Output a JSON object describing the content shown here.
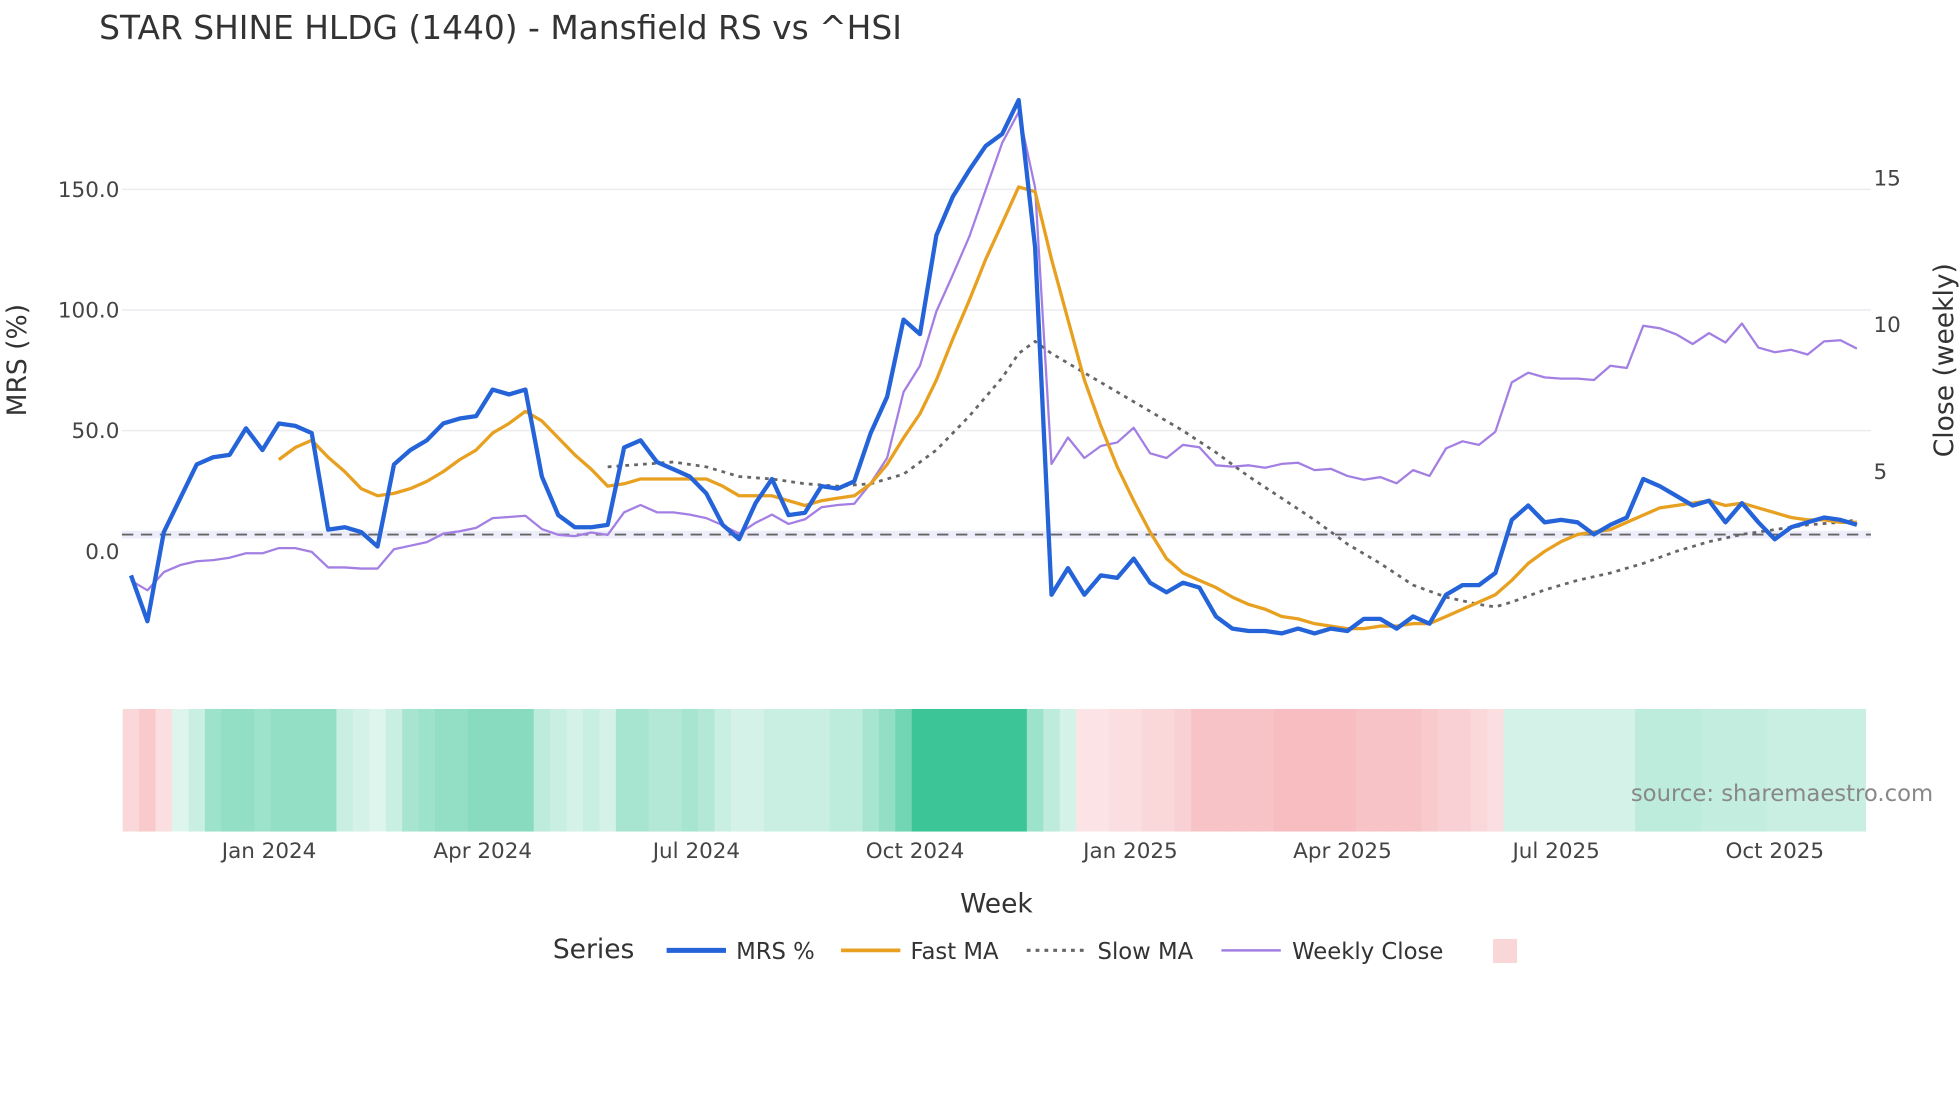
{
  "chart_data": {
    "type": "line",
    "title": "STAR SHINE HLDG (1440) - Mansfield RS vs ^HSI",
    "xlabel": "Week",
    "ylabel": "MRS (%)",
    "y2label": "Close (weekly)",
    "ylim": [
      -47,
      196
    ],
    "y2lim": [
      -1.6,
      18.4
    ],
    "yticks": [
      "0.0",
      "50.0",
      "100.0",
      "150.0"
    ],
    "ytick_values": [
      0,
      50,
      100,
      150
    ],
    "y2ticks": [
      "5",
      "10",
      "15"
    ],
    "y2tick_values": [
      5,
      10,
      15
    ],
    "x_note": "x = week index (weekly points, ~Nov 2023 to Nov 2025)",
    "xlim": [
      -0.55,
      105.85
    ],
    "xticks": [
      {
        "label": "Jan 2024",
        "x": 8.4
      },
      {
        "label": "Apr 2024",
        "x": 21.4
      },
      {
        "label": "Jul 2024",
        "x": 34.4
      },
      {
        "label": "Oct 2024",
        "x": 47.7
      },
      {
        "label": "Jan 2025",
        "x": 60.8
      },
      {
        "label": "Apr 2025",
        "x": 73.7
      },
      {
        "label": "Jul 2025",
        "x": 86.7
      },
      {
        "label": "Oct 2025",
        "x": 100.0
      }
    ],
    "grid": true,
    "legend_title": "Series",
    "legend_position": "bottom",
    "source": "source: sharemaestro.com",
    "series": [
      {
        "name": "MRS %",
        "axis": "left",
        "color": "#2563d9",
        "style": "solid",
        "start": 0,
        "values": [
          -10,
          -29,
          8,
          22,
          36,
          39,
          40,
          51,
          42,
          53,
          52,
          49,
          9,
          10,
          8,
          2,
          36,
          42,
          46,
          53,
          55,
          56,
          67,
          65,
          67,
          31,
          15,
          10,
          10,
          11,
          43,
          46,
          37,
          34,
          31,
          24,
          11,
          5,
          20,
          30,
          15,
          16,
          27,
          26,
          29,
          49,
          64,
          96,
          90,
          131,
          147,
          158,
          168,
          173,
          187,
          126,
          -18,
          -7,
          -18,
          -10,
          -11,
          -3,
          -13,
          -17,
          -13,
          -15,
          -27,
          -32,
          -33,
          -33,
          -34,
          -32,
          -34,
          -32,
          -33,
          -28,
          -28,
          -32,
          -27,
          -30,
          -18,
          -14,
          -14,
          -9,
          13,
          19,
          12,
          13,
          12,
          7,
          11,
          14,
          30,
          27,
          23,
          19,
          21,
          12,
          20,
          12,
          5,
          10,
          12,
          14,
          13,
          11
        ]
      },
      {
        "name": "Fast MA",
        "axis": "left",
        "color": "#e8a020",
        "style": "solid",
        "start": 9,
        "values": [
          38,
          43,
          46,
          39,
          33,
          26,
          23,
          24,
          26,
          29,
          33,
          38,
          42,
          49,
          53,
          58,
          54,
          47,
          40,
          34,
          27,
          28,
          30,
          30,
          30,
          30,
          30,
          27,
          23,
          23,
          23,
          21,
          19,
          21,
          22,
          23,
          28,
          36,
          47,
          57,
          71,
          88,
          104,
          121,
          136,
          151,
          149,
          121,
          96,
          71,
          52,
          35,
          21,
          8,
          -3,
          -9,
          -12,
          -15,
          -19,
          -22,
          -24,
          -27,
          -28,
          -30,
          -31,
          -32,
          -32,
          -31,
          -31,
          -30,
          -30,
          -27,
          -24,
          -21,
          -18,
          -12,
          -5,
          0,
          4,
          7,
          8,
          9,
          12,
          15,
          18,
          19,
          20,
          21,
          19,
          20,
          18,
          16,
          14,
          13,
          13,
          12,
          12
        ]
      },
      {
        "name": "Slow MA",
        "axis": "left",
        "color": "#666666",
        "style": "dotted",
        "points": [
          [
            29,
            35
          ],
          [
            31,
            36
          ],
          [
            33,
            37
          ],
          [
            35,
            35
          ],
          [
            37,
            31
          ],
          [
            39,
            30
          ],
          [
            41,
            28
          ],
          [
            43,
            27
          ],
          [
            45,
            28
          ],
          [
            47,
            32
          ],
          [
            49,
            42
          ],
          [
            51,
            56
          ],
          [
            53,
            72
          ],
          [
            54,
            82
          ],
          [
            55,
            87
          ],
          [
            56,
            82
          ],
          [
            58,
            74
          ],
          [
            60,
            66
          ],
          [
            62,
            58
          ],
          [
            64,
            50
          ],
          [
            66,
            41
          ],
          [
            68,
            31
          ],
          [
            70,
            22
          ],
          [
            72,
            13
          ],
          [
            74,
            3
          ],
          [
            76,
            -5
          ],
          [
            78,
            -14
          ],
          [
            80,
            -19
          ],
          [
            82,
            -22
          ],
          [
            83,
            -23
          ],
          [
            84,
            -21
          ],
          [
            86,
            -16
          ],
          [
            88,
            -12
          ],
          [
            90,
            -9
          ],
          [
            92,
            -5
          ],
          [
            94,
            0
          ],
          [
            96,
            4
          ],
          [
            98,
            7
          ],
          [
            100,
            9
          ],
          [
            102,
            11
          ],
          [
            104,
            12
          ],
          [
            105,
            13
          ]
        ]
      },
      {
        "name": "Weekly Close",
        "axis": "right",
        "color": "#a47fe3",
        "style": "solid",
        "start": 0,
        "values": [
          1.27,
          0.94,
          1.56,
          1.8,
          1.93,
          1.97,
          2.05,
          2.2,
          2.2,
          2.38,
          2.38,
          2.25,
          1.72,
          1.72,
          1.68,
          1.68,
          2.34,
          2.46,
          2.58,
          2.87,
          2.95,
          3.07,
          3.4,
          3.44,
          3.48,
          3.03,
          2.83,
          2.79,
          2.91,
          2.83,
          3.6,
          3.85,
          3.6,
          3.6,
          3.52,
          3.4,
          3.16,
          2.87,
          3.24,
          3.52,
          3.2,
          3.36,
          3.77,
          3.85,
          3.89,
          4.59,
          5.45,
          7.7,
          8.6,
          10.45,
          11.7,
          13.0,
          14.6,
          16.2,
          17.25,
          14.67,
          5.25,
          6.15,
          5.45,
          5.86,
          5.98,
          6.48,
          5.61,
          5.45,
          5.9,
          5.82,
          5.2,
          5.16,
          5.2,
          5.12,
          5.25,
          5.29,
          5.04,
          5.08,
          4.84,
          4.71,
          4.8,
          4.59,
          5.04,
          4.84,
          5.78,
          6.02,
          5.9,
          6.35,
          8.03,
          8.36,
          8.2,
          8.16,
          8.16,
          8.11,
          8.6,
          8.52,
          9.96,
          9.88,
          9.67,
          9.34,
          9.71,
          9.39,
          10.04,
          9.22,
          9.06,
          9.14,
          8.98,
          9.43,
          9.47,
          9.18
        ]
      }
    ],
    "heatmap": {
      "positive_color": "#26be8b",
      "negative_color": "#ee7a80",
      "values": [
        -0.3,
        -0.4,
        -0.25,
        0.15,
        0.25,
        0.45,
        0.5,
        0.5,
        0.45,
        0.5,
        0.5,
        0.5,
        0.5,
        0.25,
        0.2,
        0.15,
        0.25,
        0.4,
        0.45,
        0.5,
        0.5,
        0.55,
        0.55,
        0.55,
        0.55,
        0.3,
        0.25,
        0.2,
        0.25,
        0.2,
        0.4,
        0.4,
        0.35,
        0.35,
        0.4,
        0.35,
        0.25,
        0.2,
        0.2,
        0.25,
        0.25,
        0.25,
        0.25,
        0.3,
        0.3,
        0.4,
        0.5,
        0.65,
        0.9,
        0.9,
        0.9,
        0.9,
        0.9,
        0.9,
        0.9,
        0.45,
        0.3,
        0.2,
        -0.2,
        -0.2,
        -0.25,
        -0.25,
        -0.3,
        -0.3,
        -0.35,
        -0.45,
        -0.45,
        -0.45,
        -0.45,
        -0.45,
        -0.5,
        -0.5,
        -0.5,
        -0.5,
        -0.5,
        -0.45,
        -0.45,
        -0.45,
        -0.45,
        -0.4,
        -0.35,
        -0.35,
        -0.3,
        -0.25,
        0.2,
        0.2,
        0.2,
        0.2,
        0.2,
        0.2,
        0.2,
        0.2,
        0.3,
        0.3,
        0.3,
        0.3,
        0.28,
        0.28,
        0.28,
        0.28,
        0.25,
        0.25,
        0.25,
        0.25,
        0.25,
        0.25
      ]
    }
  }
}
